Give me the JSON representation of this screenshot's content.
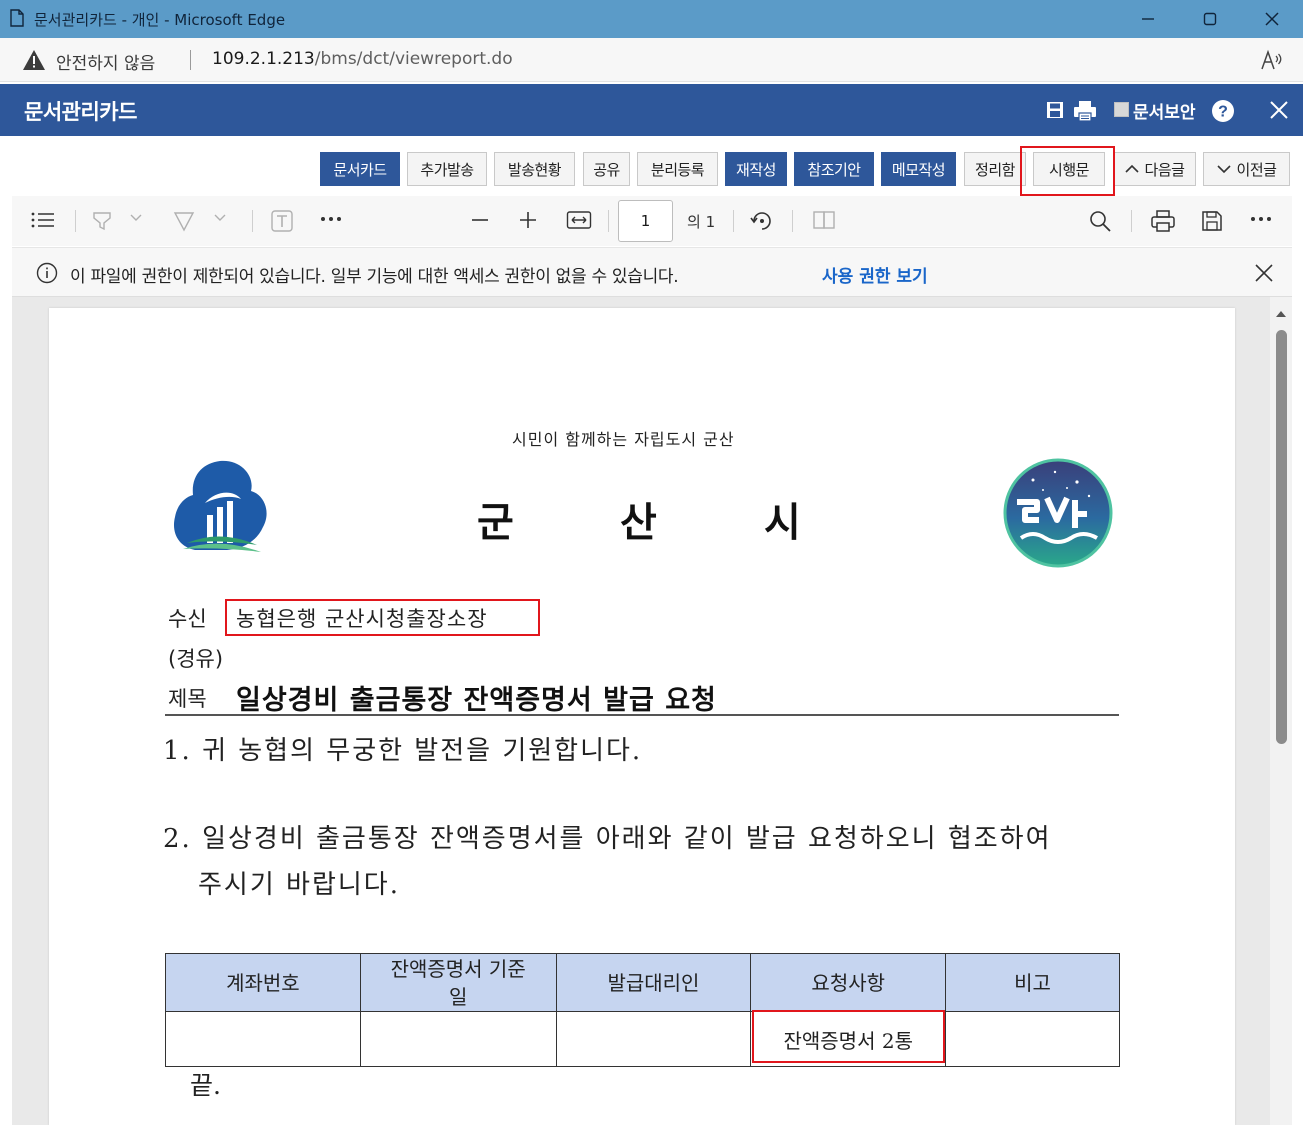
{
  "window": {
    "title": "문서관리카드 - 개인 - Microsoft Edge"
  },
  "addressbar": {
    "security_label": "안전하지 않음",
    "url_host": "109.2.1.213",
    "url_path": "/bms/dct/viewreport.do"
  },
  "app": {
    "title": "문서관리카드",
    "security_label": "문서보안"
  },
  "doc_buttons": [
    {
      "label": "문서카드",
      "active": true
    },
    {
      "label": "추가발송",
      "active": false
    },
    {
      "label": "발송현황",
      "active": false
    },
    {
      "label": "공유",
      "active": false
    },
    {
      "label": "분리등록",
      "active": false
    },
    {
      "label": "재작성",
      "active": true
    },
    {
      "label": "참조기안",
      "active": true
    },
    {
      "label": "메모작성",
      "active": true
    },
    {
      "label": "정리함",
      "active": false
    },
    {
      "label": "시행문",
      "active": false
    },
    {
      "label": "다음글",
      "active": false
    },
    {
      "label": "이전글",
      "active": false
    }
  ],
  "pdf_toolbar": {
    "page_number": "1",
    "page_of": "의 1"
  },
  "infobar": {
    "message": "이 파일에 권한이 제한되어 있습니다. 일부 기능에 대한 액세스 권한이 없을 수 있습니다.",
    "link": "사용 권한 보기"
  },
  "document": {
    "slogan": "시민이 함께하는 자립도시 군산",
    "org_chars": [
      "군",
      "산",
      "시"
    ],
    "recipient_label": "수신",
    "recipient": "농협은행 군산시청출장소장",
    "via_label": "(경유)",
    "subject_label": "제목",
    "subject": "일상경비 출금통장 잔액증명서 발급 요청",
    "para1": "1. 귀 농협의 무궁한 발전을 기원합니다.",
    "para2_line1": "2. 일상경비 출금통장 잔액증명서를 아래와 같이 발급 요청하오니 협조하여",
    "para2_line2": "주시기 바랍니다.",
    "table": {
      "headers": [
        "계좌번호",
        "잔액증명서 기준\n일",
        "발급대리인",
        "요청사항",
        "비고"
      ],
      "rows": [
        [
          "",
          "",
          "",
          "잔액증명서 2통",
          ""
        ]
      ]
    },
    "end_mark": "끝."
  },
  "colors": {
    "titlebar": "#5b9bc8",
    "app_header": "#2e579a",
    "active_button": "#2e579a",
    "highlight": "#e1161c",
    "link": "#1a66c9",
    "table_header": "#c6d5f0"
  },
  "icons": [
    "document-icon",
    "minimize-icon",
    "maximize-icon",
    "close-icon",
    "warning-icon",
    "read-aloud-icon",
    "save-icon",
    "print-icon",
    "help-icon",
    "contents-icon",
    "highlight-icon",
    "draw-icon",
    "text-icon",
    "more-icon",
    "zoom-out-icon",
    "zoom-in-icon",
    "fit-width-icon",
    "rotate-icon",
    "page-view-icon",
    "search-icon",
    "info-icon",
    "chevron-up-icon",
    "chevron-down-icon"
  ]
}
